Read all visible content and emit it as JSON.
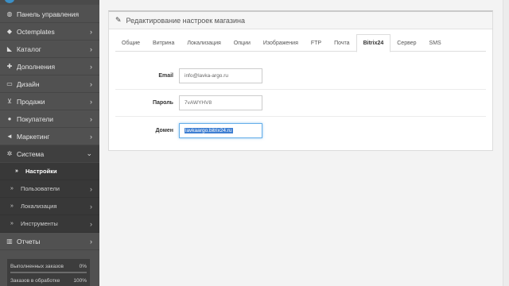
{
  "sidebar": {
    "items": [
      {
        "label": "Панель управления",
        "icon": "dashboard-icon",
        "glyph": "◍",
        "chevron": false
      },
      {
        "label": "Octemplates",
        "icon": "shield-icon",
        "glyph": "◆",
        "chevron": true
      },
      {
        "label": "Каталог",
        "icon": "tag-icon",
        "glyph": "◣",
        "chevron": true
      },
      {
        "label": "Дополнения",
        "icon": "puzzle-icon",
        "glyph": "✚",
        "chevron": true
      },
      {
        "label": "Дизайн",
        "icon": "desktop-icon",
        "glyph": "▭",
        "chevron": true
      },
      {
        "label": "Продажи",
        "icon": "cart-icon",
        "glyph": "⊻",
        "chevron": true
      },
      {
        "label": "Покупатели",
        "icon": "user-icon",
        "glyph": "●",
        "chevron": true
      },
      {
        "label": "Маркетинг",
        "icon": "share-icon",
        "glyph": "◄",
        "chevron": true
      },
      {
        "label": "Система",
        "icon": "gear-icon",
        "glyph": "✲",
        "chevron": true
      }
    ],
    "submenu": [
      {
        "label": "Настройки",
        "chevron": false
      },
      {
        "label": "Пользователи",
        "chevron": true
      },
      {
        "label": "Локализация",
        "chevron": true
      },
      {
        "label": "Инструменты",
        "chevron": true
      }
    ],
    "reports": {
      "label": "Отчеты",
      "icon": "bar-chart-icon",
      "glyph": "▥"
    },
    "chevron_right": "›",
    "chevron_down": "⌄",
    "sub_arrow": "»",
    "stats": [
      {
        "label": "Выполненных заказов",
        "value": "0%",
        "fill": 0
      },
      {
        "label": "Заказов в обработке",
        "value": "100%",
        "fill": 100
      }
    ]
  },
  "panel": {
    "title": "Редактирование настроек магазина",
    "tabs": [
      "Общие",
      "Витрина",
      "Локализация",
      "Опции",
      "Изображения",
      "FTP",
      "Почта",
      "Bitrix24",
      "Сервер",
      "SMS"
    ],
    "active_tab": "Bitrix24",
    "fields": [
      {
        "label": "Email",
        "value": "info@lavka-argo.ru"
      },
      {
        "label": "Пароль",
        "value": "7vAWYHV8"
      },
      {
        "label": "Домен",
        "value": "lavkaargo.bitrix24.ru"
      }
    ]
  },
  "colors": {
    "sidebar_bg": "#515151",
    "submenu_bg": "#383838",
    "accent": "#3f7fd2"
  }
}
